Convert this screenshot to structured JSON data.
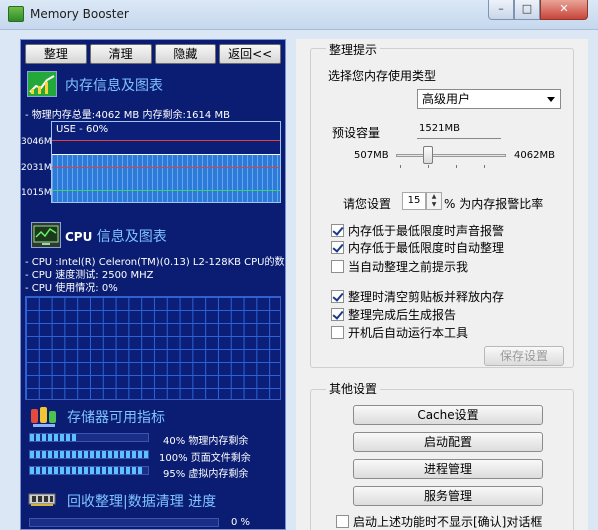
{
  "window": {
    "title": "Memory Booster",
    "minimize": "–",
    "maximize": "□",
    "close": "✕"
  },
  "left": {
    "buttons": [
      "整理",
      "清理",
      "隐藏",
      "返回<<"
    ],
    "memory": {
      "title": "内存信息及图表",
      "summary": "- 物理内存总量:4062 MB  内存剩余:1614 MB",
      "usage_label": "USE - 60%",
      "usage_percent": 60,
      "y_labels": [
        "3046M",
        "2031M",
        "1015M"
      ]
    },
    "cpu": {
      "title_prefix": "CPU",
      "title_rest": " 信息及图表",
      "lines": [
        "- CPU :Intel(R) Celeron(TM)(0.13) L2-128KB CPU的数",
        "- CPU 速度测试: 2500 MHZ",
        "- CPU 使用情况:  0%"
      ]
    },
    "storage": {
      "title": "存储器可用指标",
      "bars": [
        {
          "percent": 40,
          "text": "40% 物理内存剩余"
        },
        {
          "percent": 100,
          "text": "100% 页面文件剩余"
        },
        {
          "percent": 95,
          "text": "95% 虚拟内存剩余"
        }
      ]
    },
    "recycle": {
      "title": "回收整理|数据清理 进度",
      "percent_text": "0 %",
      "percent": 0
    }
  },
  "right": {
    "group1": {
      "title": "整理提示",
      "type_label": "选择您内存使用类型",
      "type_value": "高级用户",
      "preset_label": "预设容量",
      "preset_value": "1521MB",
      "slider_min": "507MB",
      "slider_max": "4062MB",
      "slider_value_mb": 1521,
      "threshold_prefix": "请您设置",
      "threshold_value": "15",
      "threshold_suffix": "% 为内存报警比率",
      "checks": [
        {
          "label": "内存低于最低限度时声音报警",
          "checked": true
        },
        {
          "label": "内存低于最低限度时自动整理",
          "checked": true
        },
        {
          "label": "当自动整理之前提示我",
          "checked": false
        },
        {
          "label": "整理时清空剪贴板并释放内存",
          "checked": true
        },
        {
          "label": "整理完成后生成报告",
          "checked": true
        },
        {
          "label": "开机后自动运行本工具",
          "checked": false
        }
      ],
      "save_button": "保存设置"
    },
    "group2": {
      "title": "其他设置",
      "buttons": [
        "Cache设置",
        "启动配置",
        "进程管理",
        "服务管理"
      ],
      "bottom_check": {
        "label": "启动上述功能时不显示[确认]对话框",
        "checked": false
      }
    }
  },
  "colors": {
    "panel": "#0a1d73",
    "graph_fill": "#2d7bd8",
    "accent_text": "#7fc3ff"
  }
}
